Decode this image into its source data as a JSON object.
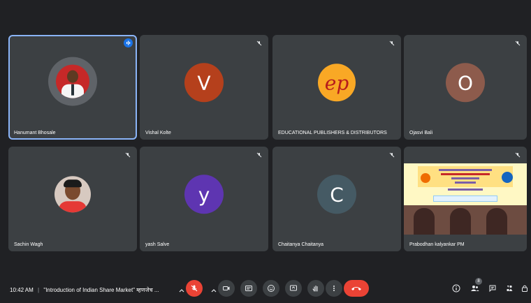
{
  "participants": [
    {
      "name": "Hanumant Bhosale",
      "avatar": "photo",
      "active": true
    },
    {
      "name": "Vishal Kolte",
      "initial": "V",
      "color": "#b5401c"
    },
    {
      "name": "EDUCATIONAL PUBLISHERS & DISTRIBUTORS",
      "avatar": "logo",
      "logo_text": "ep"
    },
    {
      "name": "Ojasvi Bali",
      "initial": "O",
      "color": "#8d5b4c"
    },
    {
      "name": "Sachin Wagh",
      "avatar": "photo"
    },
    {
      "name": "yash Salve",
      "initial": "y",
      "color": "#5e35b1"
    },
    {
      "name": "Chaitanya Chaitanya",
      "initial": "C",
      "color": "#455a64"
    },
    {
      "name": "Prabodhan kalyankar PM",
      "avatar": "screen-share"
    }
  ],
  "toolbar": {
    "time": "10:42 AM",
    "separator": "|",
    "meeting_title": "\"Introduction of Indian Share Market\" म्हणजेच ...",
    "participant_count": "8"
  },
  "colors": {
    "background": "#202124",
    "tile": "#3c4043",
    "active_border": "#8ab4f8",
    "hangup": "#ea4335"
  }
}
